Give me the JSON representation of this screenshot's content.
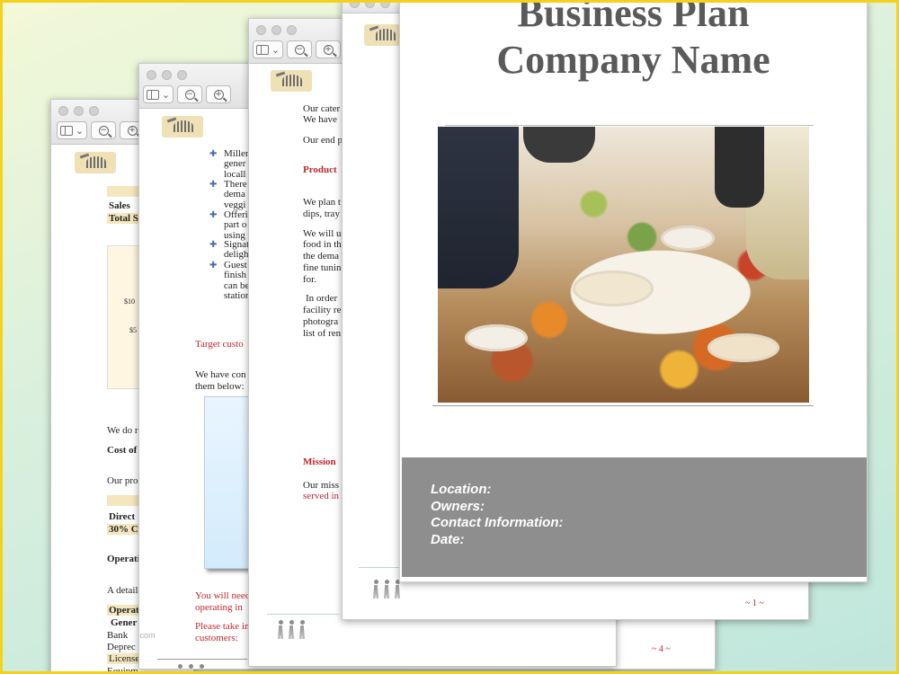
{
  "background": {
    "gradient_top": "#f3f8d8",
    "gradient_bottom": "#bfe6dc",
    "frame_color": "#f2d21c"
  },
  "window1": {
    "lines": [
      "Sales",
      "Total S",
      "$10",
      "$5",
      "We do r",
      "Cost of",
      "Our pro",
      "Direct",
      "30% Co",
      "Operati",
      "A detail",
      "Operat",
      "Gener",
      "Bank",
      "Deprec",
      "License",
      "Equipm"
    ]
  },
  "window2": {
    "bullets": [
      [
        "Miller",
        "gener",
        "locall"
      ],
      [
        "There",
        "dema",
        "veggi"
      ],
      [
        "Offeri",
        "part o",
        "using"
      ],
      [
        "Signat",
        "deligh"
      ],
      [
        "Guest",
        "finish",
        "can be",
        "station"
      ]
    ],
    "target_heading": "Target custo",
    "we_have": [
      "We have con",
      "them below:"
    ],
    "you_will": [
      "You will need",
      "operating in"
    ],
    "please_take": [
      "Please take in",
      "customers:"
    ],
    "watermark": "www.heritagechristiancollege.com",
    "page_number": "~ 4 ~"
  },
  "window3": {
    "lines": [
      "Our cater",
      "We have",
      "Our end p"
    ],
    "product_heading": "Product",
    "plan_lines": [
      "We plan t",
      "dips, tray"
    ],
    "will_lines": [
      "We will u",
      "food in th",
      "the dema",
      "fine tunin",
      "for."
    ],
    "order_lines": [
      "In order",
      "facility re",
      "photogra",
      "list of ren"
    ],
    "mission_heading": "Mission",
    "mission_lines": [
      "Our miss",
      "served in"
    ]
  },
  "cover": {
    "title_line1": "Business Plan",
    "title_line2": "Company Name",
    "fields": [
      "Location:",
      "Owners:",
      "Contact Information:",
      "Date:"
    ],
    "page_number": "~ 1 ~"
  }
}
